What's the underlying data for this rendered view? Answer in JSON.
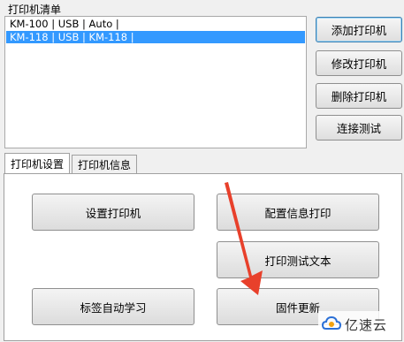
{
  "printer_list": {
    "label": "打印机清单",
    "items": [
      {
        "text": "KM-100 | USB | Auto |",
        "selected": false
      },
      {
        "text": "KM-118 | USB | KM-118 |",
        "selected": true
      }
    ]
  },
  "side_buttons": {
    "add": "添加打印机",
    "edit": "修改打印机",
    "delete": "删除打印机",
    "test": "连接测试"
  },
  "tabs": [
    {
      "label": "打印机设置",
      "active": true
    },
    {
      "label": "打印机信息",
      "active": false
    }
  ],
  "panel_buttons": {
    "setup": "设置打印机",
    "config_print": "配置信息打印",
    "print_test": "打印测试文本",
    "label_learn": "标签自动学习",
    "firmware": "固件更新"
  },
  "watermark": {
    "text": "亿速云"
  },
  "colors": {
    "selection": "#3399ff",
    "arrow": "#e8402b",
    "focus_border": "#3c7fb1"
  }
}
